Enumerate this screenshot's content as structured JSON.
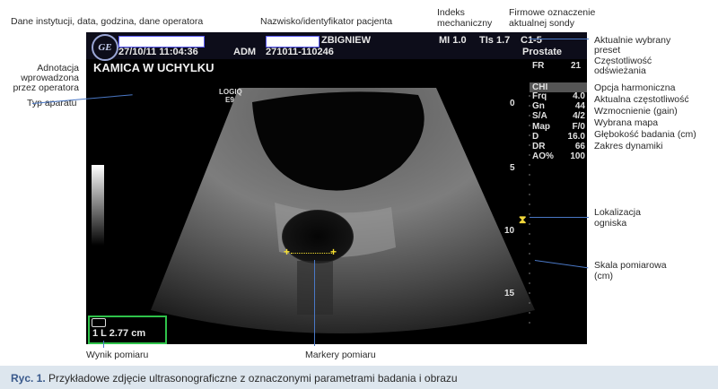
{
  "annotations": {
    "top_left": "Dane instytucji, data, godzina, dane operatora",
    "top_center": "Nazwisko/identyfikator pacjenta",
    "mi_label": [
      "Indeks",
      "mechaniczny"
    ],
    "probe_label": [
      "Firmowe oznaczenie",
      "aktualnej sondy"
    ],
    "operator_note": [
      "Adnotacja",
      "wprowadzona",
      "przez operatora"
    ],
    "device_type": "Typ aparatu",
    "right": {
      "preset": [
        "Aktualnie wybrany",
        "preset"
      ],
      "refresh": [
        "Częstotliwość",
        "odświeżania"
      ],
      "harmonic": "Opcja harmoniczna",
      "freq": "Aktualna częstotliwość",
      "gain": "Wzmocnienie (gain)",
      "map": "Wybrana mapa",
      "depth": "Głębokość badania (cm)",
      "dr": "Zakres dynamiki",
      "focus": [
        "Lokalizacja",
        "ogniska"
      ],
      "scale": [
        "Skala pomiarowa",
        "(cm)"
      ]
    },
    "bottom_result": "Wynik pomiaru",
    "bottom_markers": "Markery pomiaru"
  },
  "screen": {
    "date_time": "27/10/11 11:04:36",
    "adm": "ADM",
    "patient_name": "ZBIGNIEW",
    "patient_id": "271011-110246",
    "mi": "MI 1.0",
    "tis": "TIs 1.7",
    "probe": "C1-5",
    "preset": "Prostate",
    "annotation": "KAMICA W UCHYLKU",
    "device": [
      "LOGIQ",
      "E9"
    ],
    "fr_label": "FR",
    "fr_value": "21",
    "chi": "CHI",
    "params": [
      {
        "k": "Frq",
        "v": "4.0"
      },
      {
        "k": "Gn",
        "v": "44"
      },
      {
        "k": "S/A",
        "v": "4/2"
      },
      {
        "k": "Map",
        "v": "F/0"
      },
      {
        "k": "D",
        "v": "16.0"
      },
      {
        "k": "DR",
        "v": "66"
      },
      {
        "k": "AO%",
        "v": "100"
      }
    ],
    "scale_ticks": [
      "0",
      "5",
      "10",
      "15"
    ],
    "measurement": "1 L 2.77 cm",
    "logo": "GE"
  },
  "caption": {
    "prefix": "Ryc. 1.",
    "text": " Przykładowe zdjęcie ultrasonograficzne z oznaczonymi parametrami badania i obrazu"
  }
}
